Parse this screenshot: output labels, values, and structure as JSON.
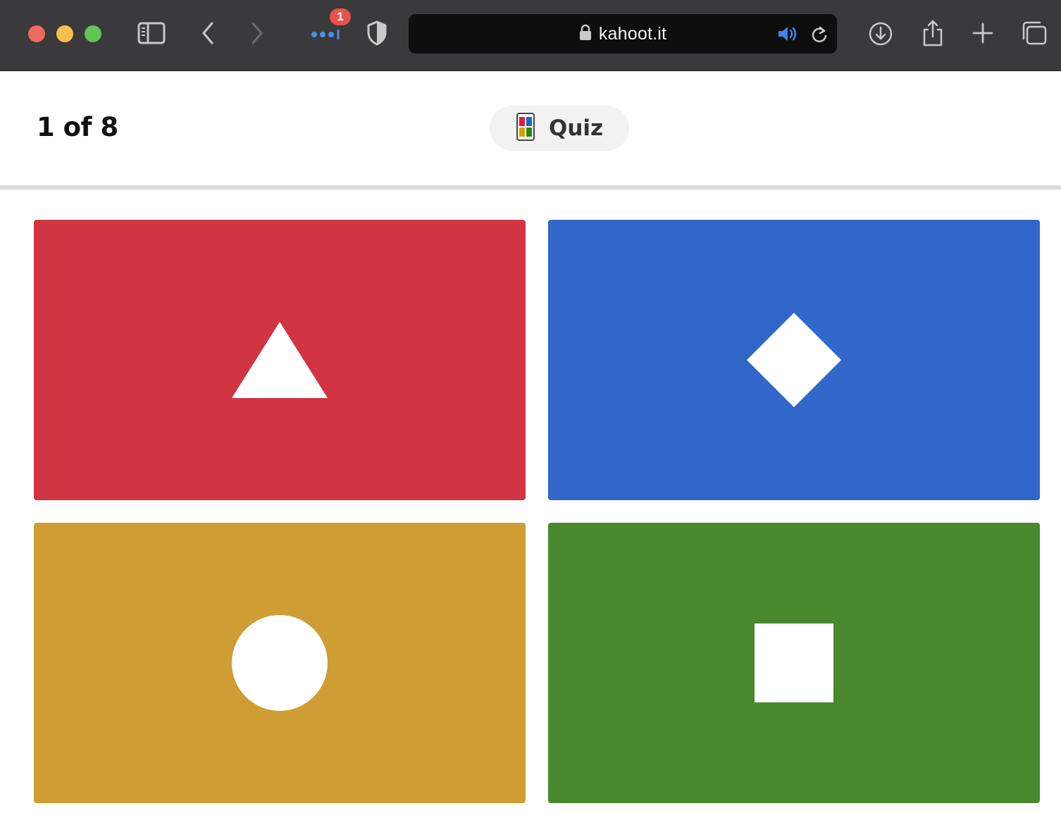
{
  "browser": {
    "url": "kahoot.it",
    "notification_count": "1"
  },
  "header": {
    "progress": "1 of 8",
    "game_type": "Quiz"
  },
  "answers": [
    {
      "name": "answer-triangle",
      "shape": "triangle-icon",
      "color": "#d13443"
    },
    {
      "name": "answer-diamond",
      "shape": "diamond-icon",
      "color": "#3067c8"
    },
    {
      "name": "answer-circle",
      "shape": "circle-icon",
      "color": "#ce9e34"
    },
    {
      "name": "answer-square",
      "shape": "square-icon",
      "color": "#49882c"
    }
  ],
  "colors": {
    "toolbar": "#3a393b",
    "red": "#d13443",
    "blue": "#3067c8",
    "yellow": "#ce9e34",
    "green": "#49882c"
  }
}
